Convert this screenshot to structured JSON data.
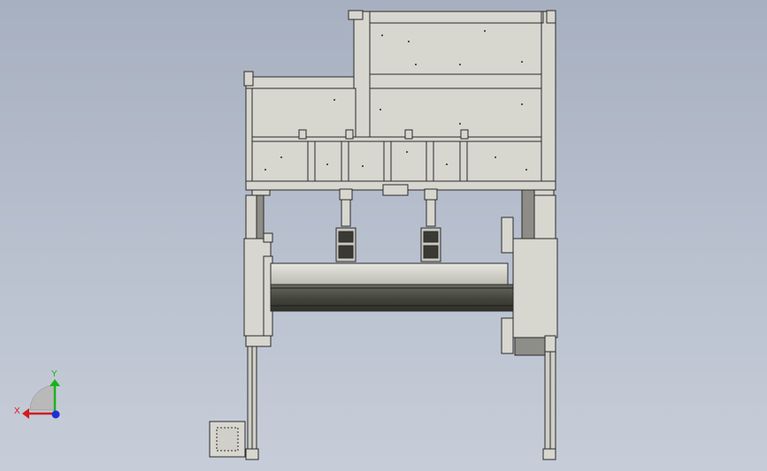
{
  "triad": {
    "x_label": "X",
    "y_label": "Y",
    "x_color": "#d21c1c",
    "y_color": "#19b319",
    "z_color": "#1f2fd6"
  },
  "colors": {
    "background_top": "#a7b0c0",
    "background_bottom": "#c7cdd8",
    "panel_fill": "#d7d6cf",
    "panel_stroke": "#2b2b2b",
    "roller_fill": "#4a4b42"
  }
}
